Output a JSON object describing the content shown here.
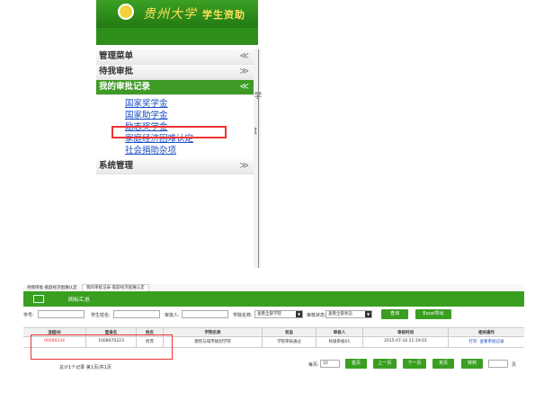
{
  "header": {
    "university_name": "贵州大学",
    "system_name": "学生资助"
  },
  "menu": {
    "title": "管理菜单",
    "title_chevron": "≪",
    "sections": [
      {
        "label": "待我审批",
        "chevron": "≫"
      },
      {
        "label": "我的审批记录",
        "chevron": "≪"
      },
      {
        "label": "系统管理",
        "chevron": "≫"
      }
    ],
    "sub_items": [
      "国家奖学金",
      "国家助学金",
      "励志奖学金",
      "家庭经济困难认定",
      "社会捐助杂项"
    ]
  },
  "right_panel_marks": [
    "学",
    "["
  ],
  "bottom": {
    "tabs": [
      "待我审批-家庭经济困难认定",
      "我的审批记录-家庭经济困难认定"
    ],
    "section_label": "困标汇总",
    "filters": {
      "student_no_label": "学号:",
      "student_name_label": "学生姓名:",
      "approver_label": "审批人:",
      "college_label": "学院名称:",
      "college_value": "查看全部学院",
      "status_label": "审核状态:",
      "status_value": "查看全部状态"
    },
    "buttons": {
      "query": "查询",
      "excel": "Excel导出"
    },
    "columns": [
      "流程ID",
      "登录名",
      "姓名",
      "学院名称",
      "状态",
      "审核人",
      "审核时间",
      "相关操作"
    ],
    "rows": [
      {
        "id": "00000144",
        "login": "1008070223",
        "name": "阿苏",
        "college": "建筑与城市规划学院",
        "status": "学院审核通过",
        "reviewer": "校级审核01",
        "time": "2015-07-16 21:19:01",
        "action_print": "打印",
        "action_view": "查看审批记录"
      }
    ],
    "pager": {
      "summary": "总计1个记录 第1页/共1页",
      "per_page_label": "每页:",
      "per_page_value": "10",
      "first": "首页",
      "prev": "上一页",
      "next": "下一页",
      "last": "末页",
      "goto": "转到",
      "page_suffix": "页"
    }
  },
  "colors": {
    "brand_green": "#3a9e20",
    "highlight_red": "#e33333",
    "link_blue": "#1a4fc4"
  }
}
